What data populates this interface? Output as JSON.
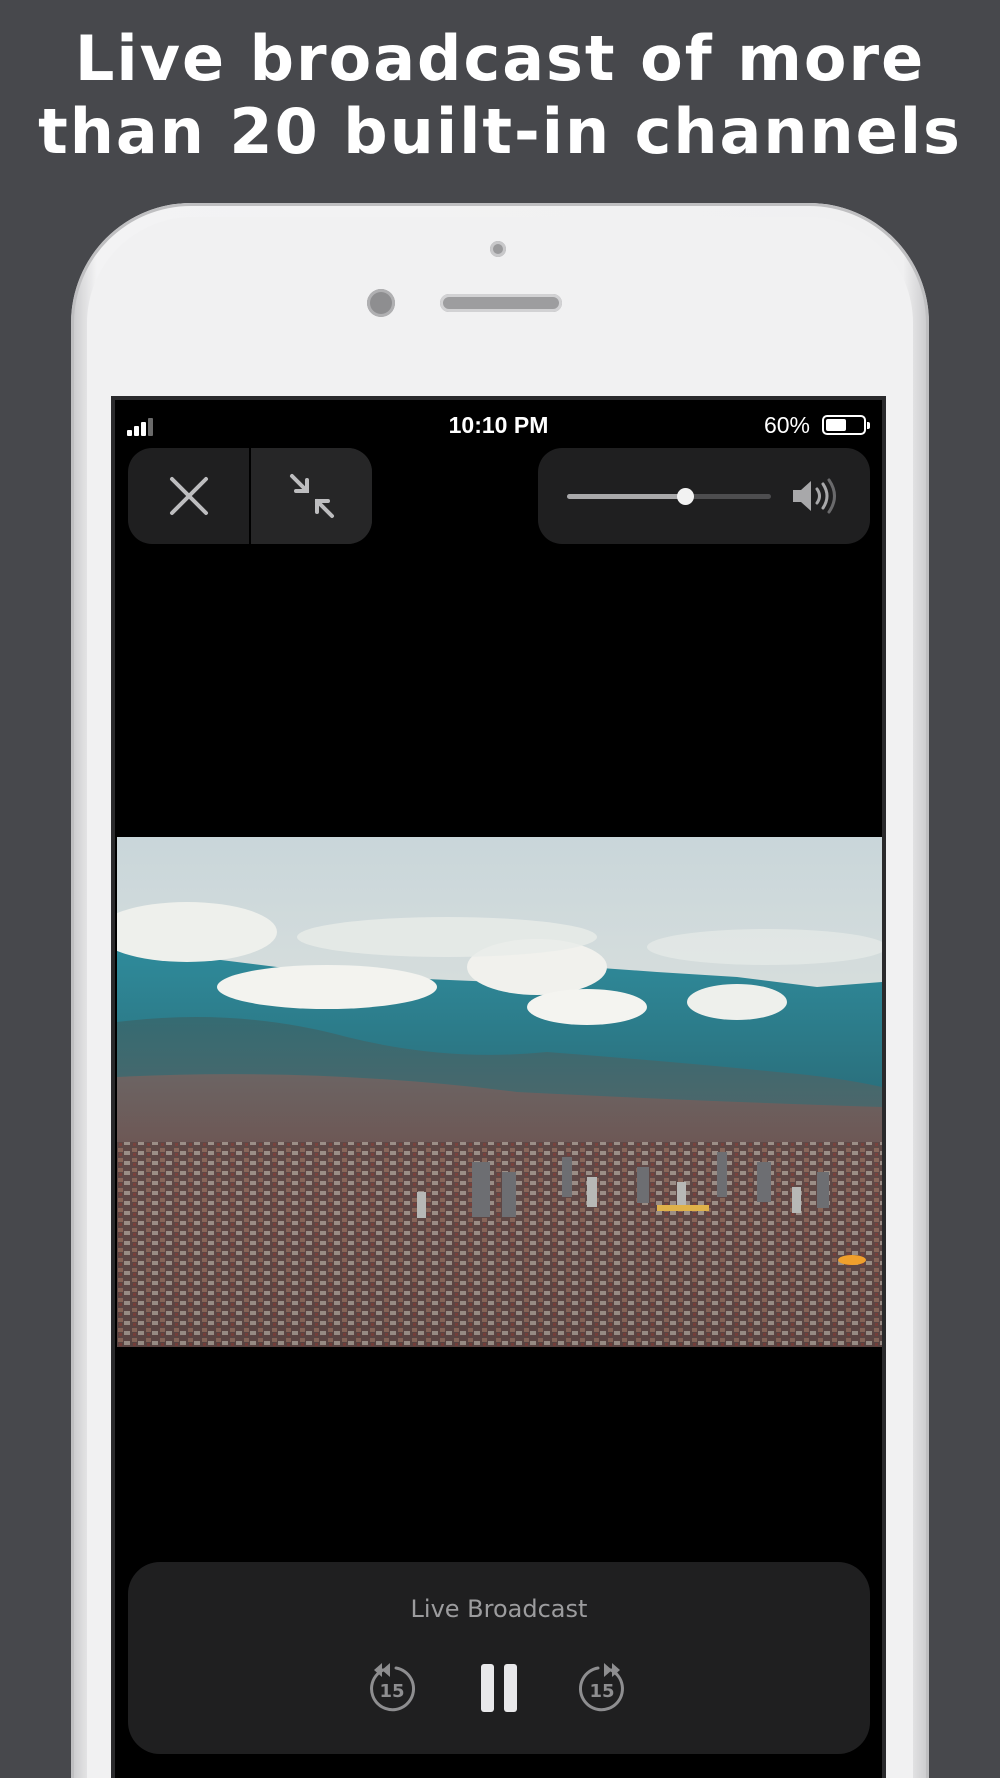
{
  "headline": {
    "line1": "Live broadcast of more",
    "line2": "than 20 built-in channels"
  },
  "status_bar": {
    "time": "10:10 PM",
    "battery_percent": "60%",
    "battery_level": 0.6,
    "signal_bars": 3
  },
  "controls": {
    "close_icon": "close-icon",
    "minimize_icon": "exit-fullscreen-icon",
    "volume_level": 0.58,
    "speaker_icon": "speaker-volume-icon"
  },
  "video": {
    "scene": "city-valley-mountains-clouds"
  },
  "player": {
    "title": "Live Broadcast",
    "skip_back_seconds": "15",
    "skip_forward_seconds": "15",
    "state": "playing"
  },
  "colors": {
    "background": "#47484c",
    "screen": "#000000",
    "panel": "#1f1f20",
    "icon": "#a8a8aa"
  }
}
